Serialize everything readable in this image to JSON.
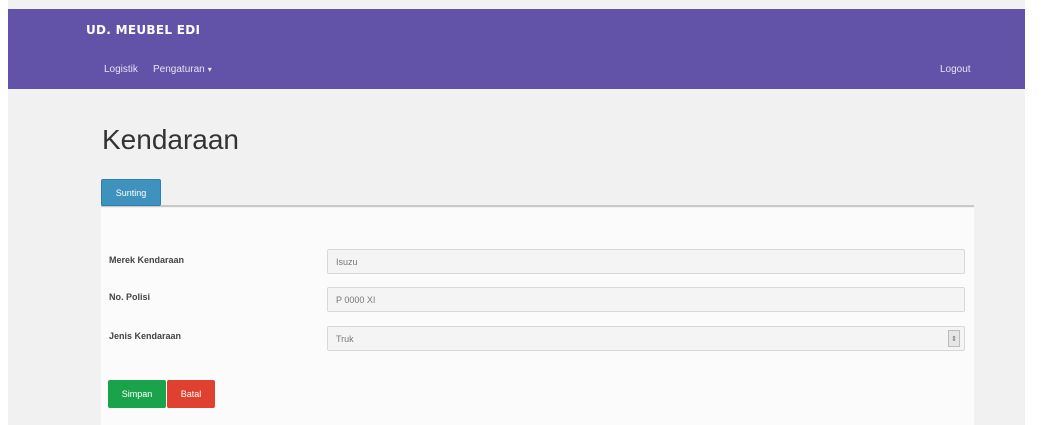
{
  "navbar": {
    "brand": "UD. MEUBEL EDI",
    "links": [
      {
        "label": "Logistik"
      },
      {
        "label": "Pengaturan"
      }
    ],
    "logout_label": "Logout",
    "color": "#6253a8"
  },
  "page": {
    "title": "Kendaraan"
  },
  "tab": {
    "label": "Sunting"
  },
  "form": {
    "fields": [
      {
        "label": "Merek Kendaraan",
        "value": "Isuzu"
      },
      {
        "label": "No. Polisi",
        "value": "P 0000 XI"
      },
      {
        "label": "Jenis Kendaraan",
        "value": "Truk"
      }
    ]
  },
  "buttons": {
    "save_label": "Simpan",
    "cancel_label": "Batal",
    "save_color": "#1ba34c",
    "cancel_color": "#e0402f"
  }
}
